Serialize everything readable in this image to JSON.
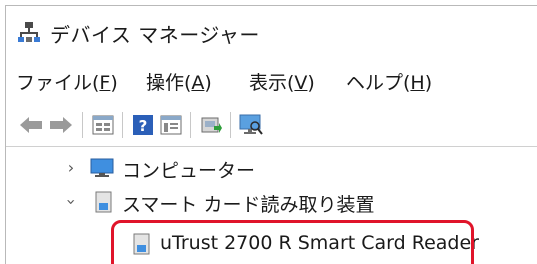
{
  "window": {
    "title": "デバイス マネージャー"
  },
  "menu": [
    {
      "label": "ファイル(",
      "key": "F",
      "suffix": ")"
    },
    {
      "label": "操作(",
      "key": "A",
      "suffix": ")"
    },
    {
      "label": "表示(",
      "key": "V",
      "suffix": ")"
    },
    {
      "label": "ヘルプ(",
      "key": "H",
      "suffix": ")"
    }
  ],
  "toolbar": {
    "icons": [
      "back-arrow-icon",
      "forward-arrow-icon",
      "properties-icon",
      "help-icon",
      "show-hidden-icon",
      "update-driver-icon",
      "monitor-scan-icon"
    ]
  },
  "tree": {
    "items": [
      {
        "label": "コンピューター",
        "state": "collapsed"
      },
      {
        "label": "スマート カード読み取り装置",
        "state": "expanded"
      },
      {
        "label": "uTrust 2700 R Smart Card Reader",
        "state": "leaf"
      }
    ]
  },
  "highlight": {
    "color": "#e0142a"
  }
}
